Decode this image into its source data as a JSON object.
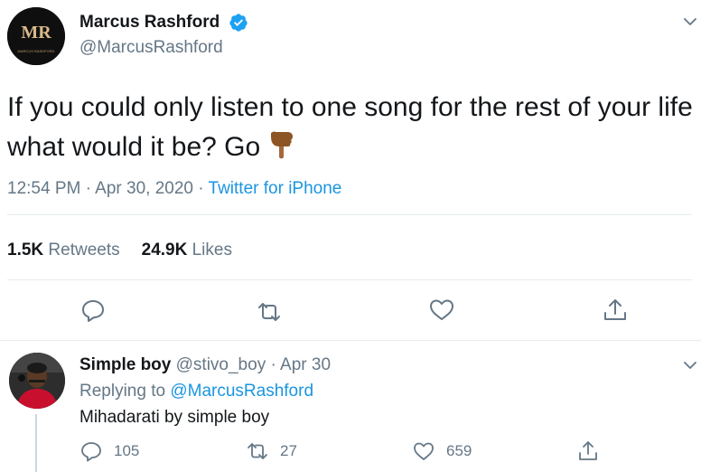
{
  "tweet": {
    "author_name": "Marcus Rashford",
    "author_handle": "@MarcusRashford",
    "avatar_monogram": "MR",
    "avatar_caption": "MARCUS RASHFORD",
    "text": "If you could only listen to one song for the rest of your life what would it be? Go",
    "text_emoji_icon": "backhand-index-pointing-down-icon",
    "time": "12:54 PM",
    "separator": " · ",
    "date": "Apr 30, 2020",
    "source": "Twitter for iPhone",
    "retweets_count": "1.5K",
    "retweets_label": " Retweets",
    "likes_count": "24.9K",
    "likes_label": " Likes",
    "actions": [
      "reply-icon",
      "retweet-icon",
      "like-icon",
      "share-icon"
    ]
  },
  "reply": {
    "author_name": "Simple boy",
    "author_handle": " @stivo_boy",
    "dot": " · ",
    "date": "Apr 30",
    "replying_prefix": "Replying to ",
    "replying_to": "@MarcusRashford",
    "text": "Mihadarati by simple boy",
    "reply_count": "105",
    "retweet_count": "27",
    "like_count": "659"
  },
  "colors": {
    "text_primary": "#14171a",
    "text_secondary": "#657786",
    "link": "#1b95e0",
    "verified": "#1da1f2",
    "divider": "#e6ecf0"
  }
}
